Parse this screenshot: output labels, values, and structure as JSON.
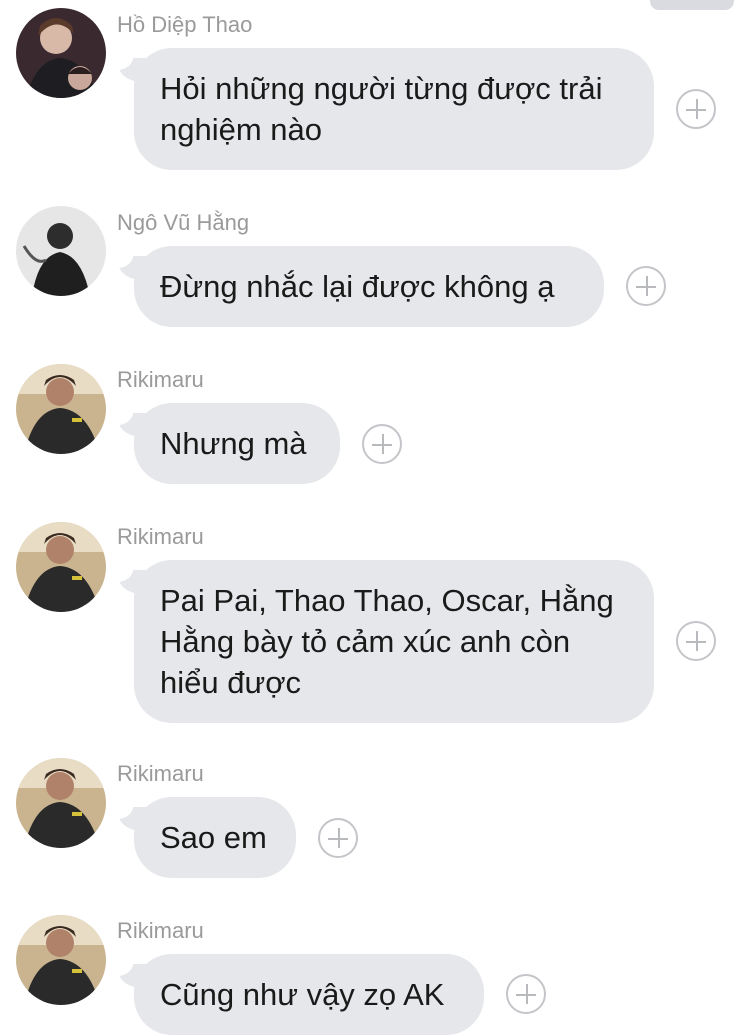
{
  "messages": [
    {
      "sender": "Hồ Diệp Thao",
      "text": "Hỏi những người từng được trải nghiệm nào",
      "avatar": "avatar-hodiepthao"
    },
    {
      "sender": "Ngô Vũ Hằng",
      "text": "Đừng nhắc lại được không ạ",
      "avatar": "avatar-ngovuhang"
    },
    {
      "sender": "Rikimaru",
      "text": "Nhưng mà",
      "avatar": "avatar-rikimaru"
    },
    {
      "sender": "Rikimaru",
      "text": "Pai Pai, Thao Thao, Oscar, Hằng Hằng bày tỏ cảm xúc anh còn hiểu được",
      "avatar": "avatar-rikimaru"
    },
    {
      "sender": "Rikimaru",
      "text": "Sao em",
      "avatar": "avatar-rikimaru"
    },
    {
      "sender": "Rikimaru",
      "text": "Cũng như vậy zọ AK",
      "avatar": "avatar-rikimaru"
    }
  ],
  "icons": {
    "react": "plus-circle-icon"
  },
  "colors": {
    "bubble": "#e5e7ea",
    "sender": "#9a9a9a",
    "text": "#1a1a1a",
    "plus": "#c3c5c9"
  }
}
